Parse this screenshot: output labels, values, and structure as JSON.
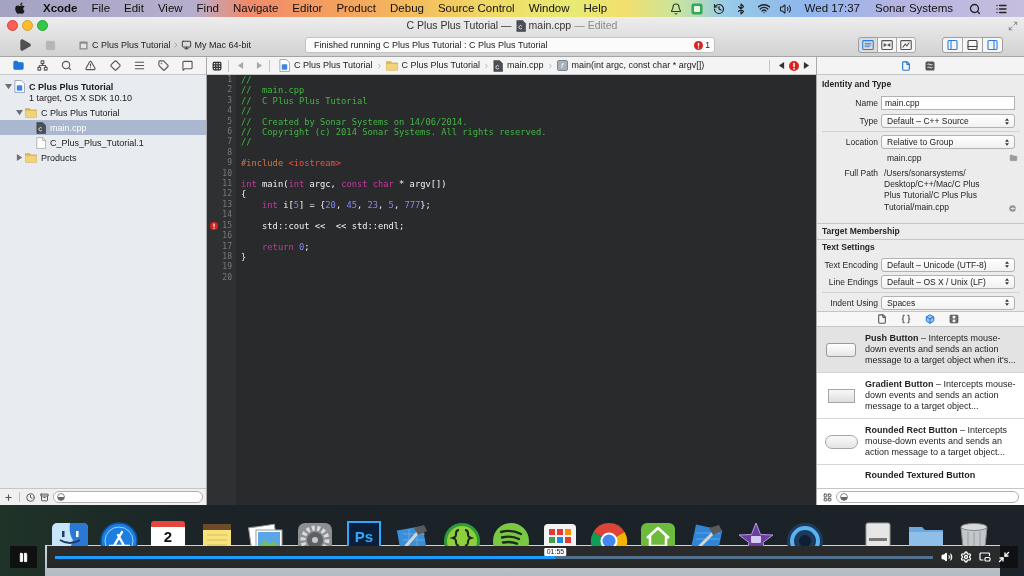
{
  "menu_bar": {
    "app": "Xcode",
    "menus": [
      "File",
      "Edit",
      "View",
      "Find",
      "Navigate",
      "Editor",
      "Product",
      "Debug",
      "Source Control",
      "Window",
      "Help"
    ],
    "clock": "Wed 17:37",
    "user": "Sonar Systems"
  },
  "window": {
    "project": "C Plus Plus Tutorial —",
    "file": "main.cpp",
    "state": "— Edited"
  },
  "toolbar": {
    "scheme": "C Plus Plus Tutorial",
    "destination": "My Mac 64-bit",
    "activity": "Finished running C Plus Plus Tutorial : C Plus Plus Tutorial",
    "issue_count": "1",
    "editor_modes": [
      {
        "kind": "standard",
        "selected": true
      },
      {
        "kind": "assistant",
        "selected": false
      },
      {
        "kind": "version",
        "selected": false
      }
    ],
    "panels": [
      {
        "kind": "navigator",
        "on": true
      },
      {
        "kind": "debug",
        "on": false
      },
      {
        "kind": "utilities",
        "on": true
      }
    ]
  },
  "navigator": {
    "tabs": [
      {
        "kind": "project",
        "selected": true
      },
      {
        "kind": "symbol",
        "selected": false
      },
      {
        "kind": "find",
        "selected": false
      },
      {
        "kind": "issue",
        "selected": false
      },
      {
        "kind": "test",
        "selected": false
      },
      {
        "kind": "debug",
        "selected": false
      },
      {
        "kind": "breakpoint",
        "selected": false
      },
      {
        "kind": "report",
        "selected": false
      }
    ],
    "tree": [
      {
        "kind": "project",
        "label": "C Plus Plus Tutorial",
        "subtitle": "1 target, OS X SDK 10.10",
        "expanded": true,
        "selected": false,
        "children": [
          {
            "kind": "folder",
            "label": "C Plus Plus Tutorial",
            "expanded": true,
            "selected": false,
            "children": [
              {
                "kind": "cpp",
                "label": "main.cpp",
                "selected": true
              },
              {
                "kind": "doc",
                "label": "C_Plus_Plus_Tutorial.1",
                "selected": false
              }
            ]
          },
          {
            "kind": "folder",
            "label": "Products",
            "expanded": false,
            "selected": false
          }
        ]
      }
    ]
  },
  "jump_bar": {
    "path": [
      {
        "kind": "project",
        "label": "C Plus Plus Tutorial"
      },
      {
        "kind": "folder",
        "label": "C Plus Plus Tutorial"
      },
      {
        "kind": "cpp",
        "label": "main.cpp"
      },
      {
        "kind": "function",
        "letter": "f",
        "label": "main(int argc, const char * argv[])"
      }
    ]
  },
  "editor": {
    "lines": [
      {
        "number": "1",
        "error": false,
        "tokens": [
          {
            "kind": "comment",
            "text": "//"
          }
        ]
      },
      {
        "number": "2",
        "error": false,
        "tokens": [
          {
            "kind": "comment",
            "text": "//  main.cpp"
          }
        ]
      },
      {
        "number": "3",
        "error": false,
        "tokens": [
          {
            "kind": "comment",
            "text": "//  C Plus Plus Tutorial"
          }
        ]
      },
      {
        "number": "4",
        "error": false,
        "tokens": [
          {
            "kind": "comment",
            "text": "//"
          }
        ]
      },
      {
        "number": "5",
        "error": false,
        "tokens": [
          {
            "kind": "comment",
            "text": "//  Created by Sonar Systems on 14/06/2014."
          }
        ]
      },
      {
        "number": "6",
        "error": false,
        "tokens": [
          {
            "kind": "comment",
            "text": "//  Copyright (c) 2014 Sonar Systems. All rights reserved."
          }
        ]
      },
      {
        "number": "7",
        "error": false,
        "tokens": [
          {
            "kind": "comment",
            "text": "//"
          }
        ]
      },
      {
        "number": "8",
        "error": false
      },
      {
        "number": "9",
        "error": false,
        "tokens": [
          {
            "kind": "preprocessor",
            "text": "#include "
          },
          {
            "kind": "include",
            "text": "<iostream>"
          }
        ]
      },
      {
        "number": "10",
        "error": false
      },
      {
        "number": "11",
        "error": false,
        "tokens": [
          {
            "kind": "keyword",
            "text": "int"
          },
          {
            "kind": "plain",
            "text": " main("
          },
          {
            "kind": "keyword",
            "text": "int"
          },
          {
            "kind": "plain",
            "text": " argc, "
          },
          {
            "kind": "keyword",
            "text": "const"
          },
          {
            "kind": "keyword",
            "text": " char"
          },
          {
            "kind": "plain",
            "text": " * argv[])"
          }
        ]
      },
      {
        "number": "12",
        "error": false,
        "tokens": [
          {
            "kind": "plain",
            "text": "{"
          }
        ]
      },
      {
        "number": "13",
        "error": false,
        "tokens": [
          {
            "kind": "keyword",
            "text": "    int"
          },
          {
            "kind": "plain",
            "text": " i["
          },
          {
            "kind": "number",
            "text": "5"
          },
          {
            "kind": "plain",
            "text": "] = {"
          },
          {
            "kind": "number",
            "text": "20"
          },
          {
            "kind": "plain",
            "text": ", "
          },
          {
            "kind": "number",
            "text": "45"
          },
          {
            "kind": "plain",
            "text": ", "
          },
          {
            "kind": "number",
            "text": "23"
          },
          {
            "kind": "plain",
            "text": ", "
          },
          {
            "kind": "number",
            "text": "5"
          },
          {
            "kind": "plain",
            "text": ", "
          },
          {
            "kind": "number",
            "text": "777"
          },
          {
            "kind": "plain",
            "text": "};"
          }
        ]
      },
      {
        "number": "14",
        "error": false
      },
      {
        "number": "15",
        "error": true,
        "tokens": [
          {
            "kind": "plain",
            "text": "    std::cout <<  << std::endl;"
          }
        ]
      },
      {
        "number": "16",
        "error": false
      },
      {
        "number": "17",
        "error": false,
        "tokens": [
          {
            "kind": "keyword",
            "text": "    return "
          },
          {
            "kind": "number",
            "text": "0"
          },
          {
            "kind": "plain",
            "text": ";"
          }
        ]
      },
      {
        "number": "18",
        "error": false,
        "tokens": [
          {
            "kind": "plain",
            "text": "}"
          }
        ]
      },
      {
        "number": "19",
        "error": false
      },
      {
        "number": "20",
        "error": false
      }
    ]
  },
  "inspector": {
    "tabs": [
      {
        "kind": "file",
        "selected": true
      },
      {
        "kind": "help",
        "selected": false
      }
    ],
    "identity": {
      "title": "Identity and Type",
      "name_label": "Name",
      "name": "main.cpp",
      "type_label": "Type",
      "type": "Default – C++ Source",
      "location_label": "Location",
      "location": "Relative to Group",
      "relative_path": "main.cpp",
      "full_path_label": "Full Path",
      "full_path": [
        "/Users/sonarsystems/",
        "Desktop/C++/Mac/C Plus",
        "Plus Tutorial/C Plus Plus",
        "Tutorial/main.cpp"
      ]
    },
    "target_membership": {
      "title": "Target Membership"
    },
    "text_settings": {
      "title": "Text Settings",
      "fields": [
        {
          "label": "Text Encoding",
          "value": "Default – Unicode (UTF-8)"
        },
        {
          "label": "Line Endings",
          "value": "Default – OS X / Unix (LF)"
        },
        {
          "label": "Indent Using",
          "value": "Spaces"
        }
      ]
    }
  },
  "library": {
    "tabs": [
      {
        "kind": "file",
        "selected": false
      },
      {
        "kind": "snippet",
        "selected": false
      },
      {
        "kind": "object",
        "selected": true
      },
      {
        "kind": "media",
        "selected": false
      }
    ],
    "items": [
      {
        "kind": "push",
        "title": "Push Button",
        "description": "– Intercepts mouse-down events and sends an action message to a target object when it's...",
        "selected": true
      },
      {
        "kind": "gradient",
        "title": "Gradient Button",
        "description": "– Intercepts mouse-down events and sends an action message to a target object...",
        "selected": false
      },
      {
        "kind": "rounded",
        "title": "Rounded Rect Button",
        "description": "– Intercepts mouse-down events and sends an action message to a target object...",
        "selected": false
      },
      {
        "kind": "textured",
        "title": "Rounded Textured Button",
        "selected": false
      }
    ]
  },
  "dock": {
    "apps": [
      {
        "kind": "face"
      },
      {
        "kind": "pencils"
      },
      {
        "kind": "calendar",
        "label": "2"
      },
      {
        "kind": "notepad"
      },
      {
        "kind": "photos"
      },
      {
        "kind": "gears"
      },
      {
        "kind": "tile",
        "label": "Ps"
      },
      {
        "kind": "hammer"
      },
      {
        "kind": "braces"
      },
      {
        "kind": "waves"
      },
      {
        "kind": "tiles"
      },
      {
        "kind": "ring"
      },
      {
        "kind": "house"
      },
      {
        "kind": "blueprint"
      },
      {
        "kind": "star"
      },
      {
        "kind": "lens"
      }
    ],
    "stacks": [
      {
        "kind": "tray"
      },
      {
        "kind": "folder"
      },
      {
        "kind": "trash"
      }
    ]
  },
  "player": {
    "playing": true,
    "level": 0.57,
    "time": "01:55"
  }
}
